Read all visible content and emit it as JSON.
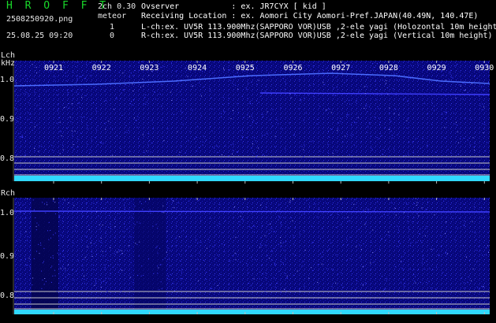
{
  "header": {
    "title": "H R O F F T",
    "version": "2ch 0.30",
    "meteor_label": "meteor",
    "filename": "2508250920.png",
    "timestamp": "25.08.25 09:20",
    "lch_count": "1",
    "rch_count": "0",
    "observer": "Ovserver           : ex. JR7CYX [ kid ]",
    "location": "Receiving Location : ex. Aomori City Aomori-Pref.JAPAN(40.49N, 140.47E)",
    "lch_desc": "L-ch:ex. UV5R 113.900Mhz(SAPPORO VOR)USB ,2-ele yagi (Holozontal 10m height)",
    "rch_desc": "R-ch:ex. UV5R 113.900Mhz(SAPPORO VOR)USB ,2-ele yagi (Vertical 10m height)"
  },
  "lch": {
    "label": "Lch",
    "unit": "kHz",
    "y_ticks": [
      "1.0",
      "0.9",
      "0.8"
    ]
  },
  "rch": {
    "label": "Rch",
    "y_ticks": [
      "1.0",
      "0.9",
      "0.8"
    ]
  },
  "time_ticks": [
    "0921",
    "0922",
    "0923",
    "0924",
    "0925",
    "0926",
    "0927",
    "0928",
    "0929",
    "0930"
  ],
  "colors": {
    "background": "#000000",
    "spectrogram": "#0a0a88",
    "noise_band": "#30d8ff",
    "title": "#19d82a"
  }
}
